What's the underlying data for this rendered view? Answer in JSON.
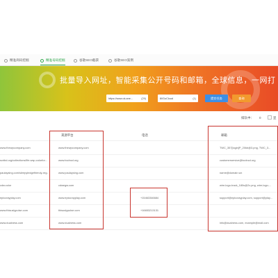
{
  "tabs": [
    {
      "label": "精准商码挖掘",
      "active": false
    },
    {
      "label": "精准号码挖掘",
      "active": true
    },
    {
      "label": "谷歌SEO截获",
      "active": false
    },
    {
      "label": "谷歌SEO案例",
      "active": false
    }
  ],
  "banner": {
    "title": "批量导入网址，智能采集公开号码和邮箱，全球信息，一网打",
    "url_input": {
      "value": "https://www.ok.ane...",
      "count": "(29)"
    },
    "proxy_input": {
      "value": "8i/GoCloud",
      "count": "(1)"
    },
    "submit_button": "提交任务",
    "query_button": "查询"
  },
  "toolbar": {
    "sort_label": "排队中：",
    "sort_count": "0",
    "more_label": "显"
  },
  "table": {
    "headers": {
      "platform": "来源平台",
      "phone": "电话",
      "email": "邮箱"
    },
    "rows": [
      {
        "url": "www.thewpcompany.com",
        "platform": "www.thewpcompany.com",
        "phone": "",
        "email": "TWC_357[login]P_20kb@3.png, TWC_3..."
      },
      {
        "url": "scribd.org/collections/life-wsp-colorfor...",
        "platform": "www.bcdncd.org",
        "phone": "",
        "email": "customerservice@bcdncd.org"
      },
      {
        "url": "paulaysing.com/sleepyledgefriendy-reg...",
        "platform": "www.paulaysing.com",
        "phone": "",
        "email": "name@domain.wx"
      },
      {
        "url": "cdw.color",
        "platform": "cdwegw.com",
        "phone": "",
        "email": "wire-logo-track_180s@2x.png, wire-logo-..."
      },
      {
        "url": "epiccrayplay.com",
        "platform": "www.epiccrayplay.com",
        "phone": "+15463346684",
        "email": "support@epiccrayplay.com, support@play..."
      },
      {
        "url": "www.thisuslypulse.com",
        "platform": "thisuslypulse.com",
        "phone": "+16653213131",
        "email": ""
      },
      {
        "url": "www.dualness.com",
        "platform": "www.dualness.com",
        "phone": "",
        "email": "info@dualness.com, example@mail.com"
      }
    ]
  },
  "colors": {
    "accent_green": "#2fa74c",
    "highlight_red": "#c8332d",
    "button_blue": "#3d8fe6",
    "button_orange": "#f29a2e"
  }
}
